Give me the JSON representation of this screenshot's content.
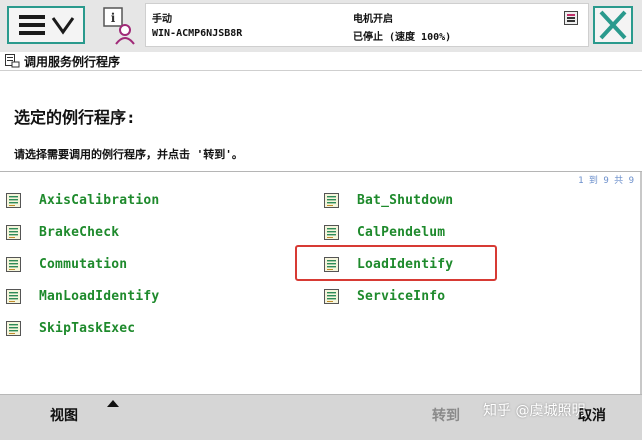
{
  "header": {
    "mode": "手动",
    "controller": "WIN-ACMP6NJSB8R",
    "motor_state": "电机开启",
    "run_state": "已停止 (速度 100%)",
    "icons": {
      "menu": "hamburger-menu-icon",
      "dropdown": "chevron-down-icon",
      "status": "user-info-icon",
      "status_indicator": "status-indicator-icon",
      "close": "close-icon"
    }
  },
  "window": {
    "title": "调用服务例行程序",
    "icon": "program-window-icon"
  },
  "main": {
    "heading": "选定的例行程序:",
    "instruction": "请选择需要调用的例行程序，并点击 '转到'。",
    "pagination": "1 到 9 共 9",
    "routines": [
      {
        "label": "AxisCalibration"
      },
      {
        "label": "Bat_Shutdown"
      },
      {
        "label": "BrakeCheck"
      },
      {
        "label": "CalPendelum"
      },
      {
        "label": "Commutation"
      },
      {
        "label": "LoadIdentify"
      },
      {
        "label": "ManLoadIdentify"
      },
      {
        "label": "ServiceInfo"
      },
      {
        "label": "SkipTaskExec"
      }
    ],
    "highlighted": "LoadIdentify"
  },
  "footer": {
    "view_label": "视图",
    "goto_label": "转到",
    "cancel_label": "取消",
    "watermark": "知乎 @虞城照明"
  },
  "colors": {
    "accent": "#2a9a8d",
    "routine_text": "#1e8a2c",
    "highlight": "#d73a34",
    "pagination": "#6a8ecb"
  }
}
